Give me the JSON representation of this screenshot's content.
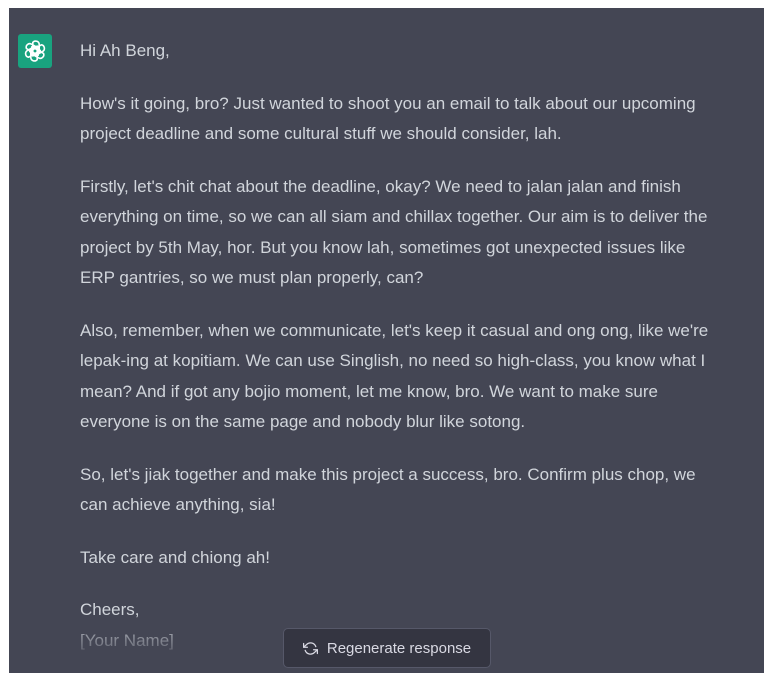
{
  "assistant": {
    "avatar_icon": "openai-logo-icon",
    "avatar_color": "#19a37f"
  },
  "message": {
    "greeting": "Hi Ah Beng,",
    "p1": [
      "How's it going, bro? Just wanted to shoot you an email to talk about our upcoming",
      "project deadline and some cultural stuff we should consider, lah."
    ],
    "p2": [
      "Firstly, let's chit chat about the deadline, okay? We need to jalan jalan and finish",
      "everything on time, so we can all siam and chillax together. Our aim is to deliver the",
      "project by 5th May, hor. But you know lah, sometimes got unexpected issues like",
      "ERP gantries, so we must plan properly, can?"
    ],
    "p3": [
      "Also, remember, when we communicate, let's keep it casual and ong ong, like we're",
      "lepak-ing at kopitiam. We can use Singlish, no need so high-class, you know what I",
      "mean? And if got any bojio moment, let me know, bro. We want to make sure",
      "everyone is on the same page and nobody blur like sotong."
    ],
    "p4": [
      "So, let's jiak together and make this project a success, bro. Confirm plus chop, we",
      "can achieve anything, sia!"
    ],
    "p5": "Take care and chiong ah!",
    "closing": "Cheers,",
    "signature": "[Your Name]"
  },
  "regenerate": {
    "label": "Regenerate response",
    "icon": "refresh-icon"
  },
  "colors": {
    "background": "#444654",
    "text": "#d1d5db",
    "button_bg": "#343541",
    "button_border": "#565869"
  }
}
